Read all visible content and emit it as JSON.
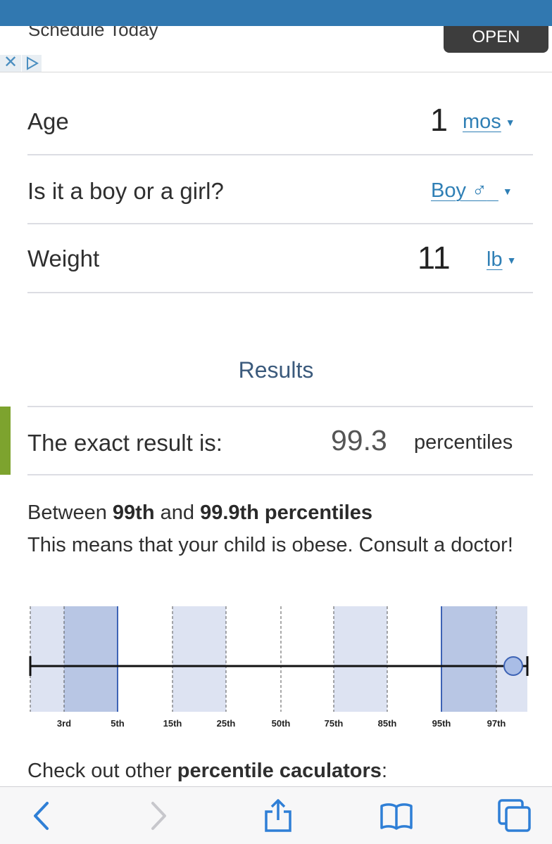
{
  "ad": {
    "text": "Schedule Today",
    "open_label": "OPEN",
    "close_glyph": "✕"
  },
  "form": {
    "age": {
      "label": "Age",
      "value": "1",
      "unit": "mos"
    },
    "sex": {
      "label": "Is it a boy or a girl?",
      "value": "Boy ♂"
    },
    "weight": {
      "label": "Weight",
      "value": "11",
      "unit": "lb"
    }
  },
  "results": {
    "title": "Results",
    "exact_label": "The exact result is:",
    "exact_value": "99.3",
    "exact_unit": "percentiles",
    "between_prefix": "Between ",
    "between_low": "99th",
    "between_mid": " and ",
    "between_high": "99.9th percentiles",
    "message": "This means that your child is obese. Consult a doctor!"
  },
  "chart_data": {
    "type": "percentile-band",
    "ticks": [
      "3rd",
      "5th",
      "15th",
      "25th",
      "50th",
      "75th",
      "85th",
      "95th",
      "97th"
    ],
    "marker_value": 99.3,
    "colors": {
      "light_band": "#dde3f2",
      "dark_band": "#b8c6e4",
      "marker": "#a9bde6",
      "marker_stroke": "#3d63b5"
    }
  },
  "footer": {
    "check_prefix": "Check out other ",
    "check_bold": "percentile caculators",
    "check_suffix": ":"
  },
  "toolbar": {
    "icons": [
      "back-icon",
      "forward-icon",
      "share-icon",
      "bookmarks-icon",
      "tabs-icon"
    ]
  }
}
